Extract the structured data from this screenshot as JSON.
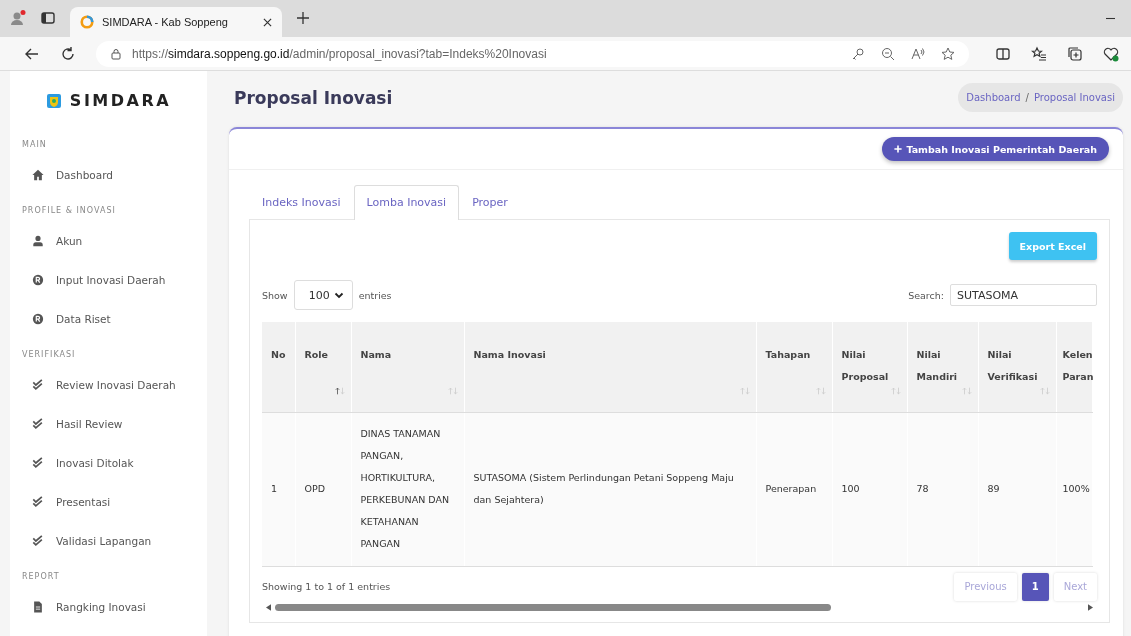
{
  "browser": {
    "tab_title": "SIMDARA - Kab Soppeng",
    "url_prefix": "https://",
    "url_domain": "simdara.soppeng.go.id",
    "url_path": "/admin/proposal_inovasi?tab=Indeks%20Inovasi"
  },
  "sidebar": {
    "brand": "SIMDARA",
    "sections": [
      {
        "heading": "MAIN",
        "items": [
          {
            "label": "Dashboard",
            "kind": "home"
          }
        ]
      },
      {
        "heading": "PROFILE & INOVASI",
        "items": [
          {
            "label": "Akun",
            "kind": "user"
          },
          {
            "label": "Input Inovasi Daerah",
            "kind": "registered"
          },
          {
            "label": "Data Riset",
            "kind": "registered"
          }
        ]
      },
      {
        "heading": "VERIFIKASI",
        "items": [
          {
            "label": "Review Inovasi Daerah",
            "kind": "check"
          },
          {
            "label": "Hasil Review",
            "kind": "check"
          },
          {
            "label": "Inovasi Ditolak",
            "kind": "check"
          },
          {
            "label": "Presentasi",
            "kind": "check"
          },
          {
            "label": "Validasi Lapangan",
            "kind": "check"
          }
        ]
      },
      {
        "heading": "REPORT",
        "items": [
          {
            "label": "Rangking Inovasi",
            "kind": "file"
          }
        ]
      }
    ]
  },
  "page_title": "Proposal Inovasi",
  "breadcrumb": {
    "items": [
      "Dashboard",
      "Proposal Inovasi"
    ],
    "separator": "/"
  },
  "add_button": "Tambah Inovasi Pemerintah Daerah",
  "tabs": [
    {
      "label": "Indeks Inovasi",
      "selected": false
    },
    {
      "label": "Lomba Inovasi",
      "selected": true
    },
    {
      "label": "Proper",
      "selected": false
    }
  ],
  "export_button": "Export Excel",
  "length": {
    "before": "Show",
    "value": "100",
    "after": "entries"
  },
  "search": {
    "label": "Search:",
    "value": "SUTASOMA"
  },
  "table": {
    "columns": [
      {
        "label": "No"
      },
      {
        "label": "Role",
        "sorted": true
      },
      {
        "label": "Nama",
        "sorted": false
      },
      {
        "label": "Nama Inovasi",
        "sorted": false
      },
      {
        "label": "Tahapan",
        "sorted": false
      },
      {
        "label": "Nilai Proposal",
        "sorted": false
      },
      {
        "label": "Nilai Mandiri",
        "sorted": false
      },
      {
        "label": "Nilai Verifikasi",
        "sorted": false
      },
      {
        "label": "Kelen Paran"
      }
    ],
    "rows": [
      [
        "1",
        "OPD",
        "DINAS TANAMAN PANGAN, HORTIKULTURA, PERKEBUNAN DAN KETAHANAN PANGAN",
        "SUTASOMA (Sistem Perlindungan Petani Soppeng Maju dan Sejahtera)",
        "Penerapan",
        "100",
        "78",
        "89",
        "100%"
      ]
    ]
  },
  "info": "Showing 1 to 1 of 1 entries",
  "pagination": [
    {
      "label": "Previous",
      "disabled": true,
      "selected": false
    },
    {
      "label": "1",
      "disabled": false,
      "selected": true
    },
    {
      "label": "Next",
      "disabled": true,
      "selected": false
    }
  ]
}
